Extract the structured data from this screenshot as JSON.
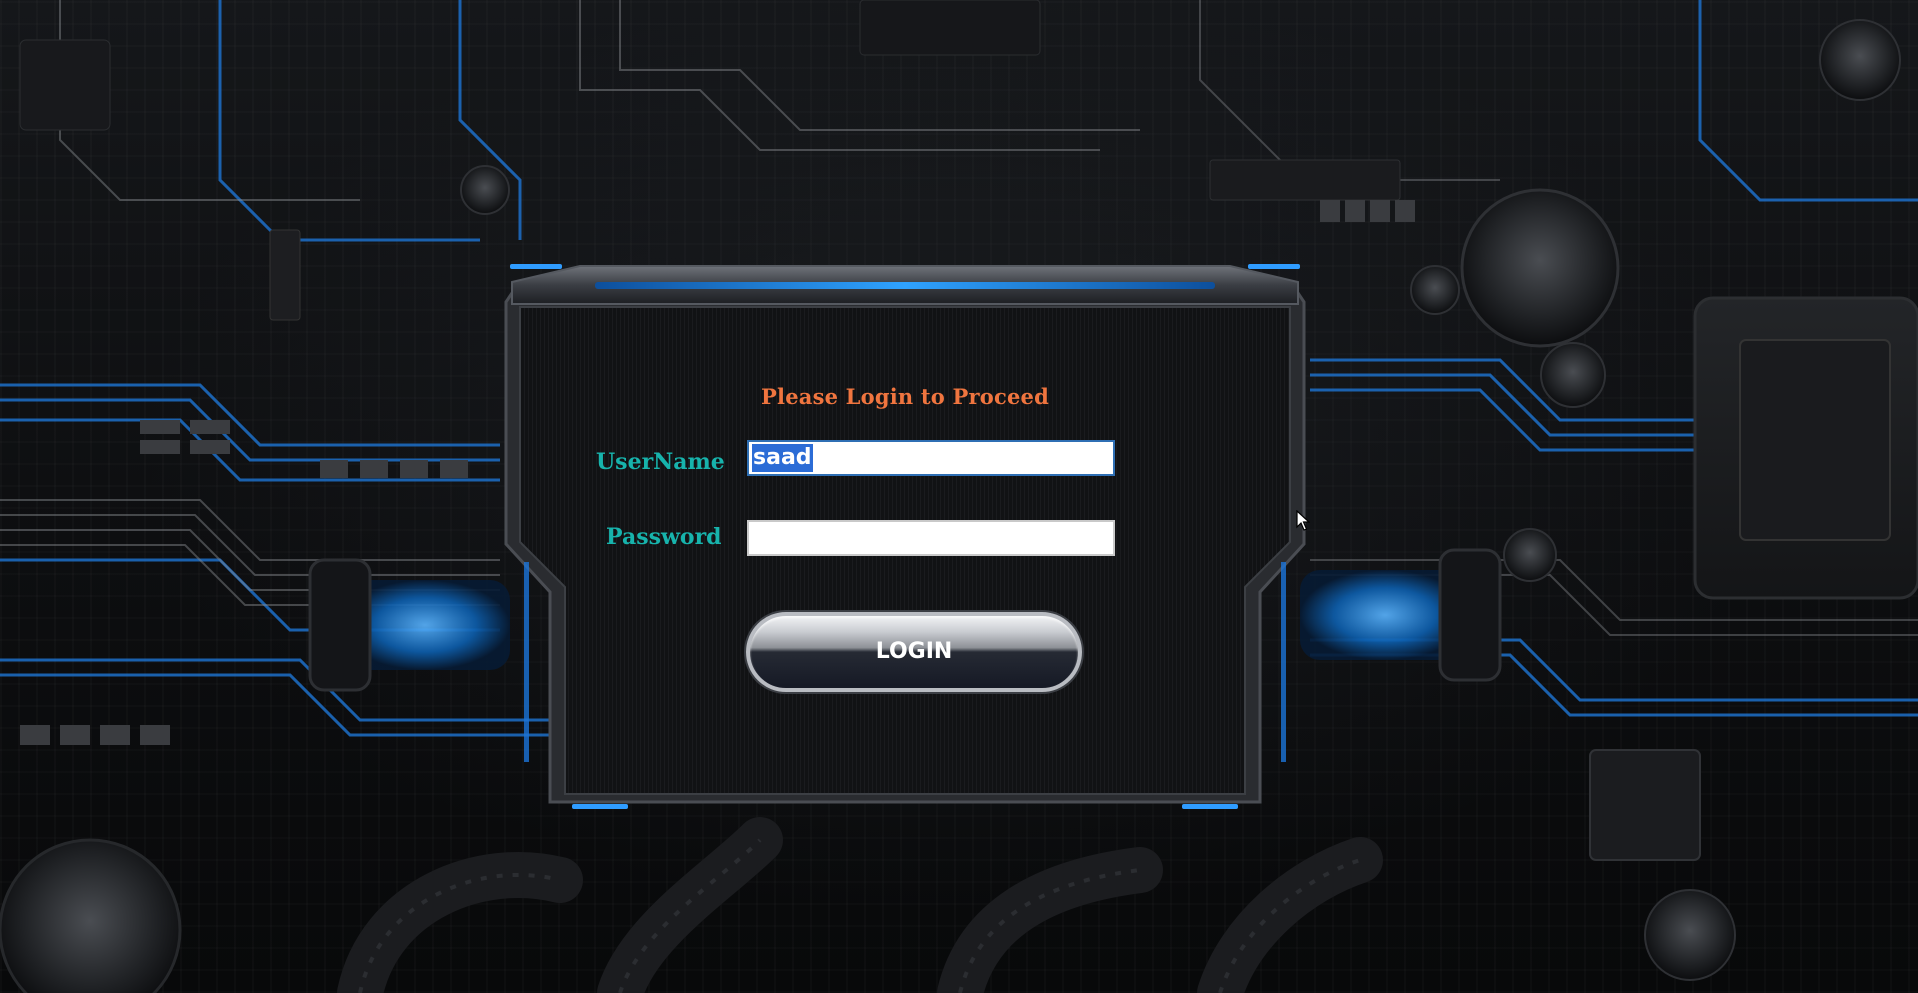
{
  "login": {
    "heading": "Please Login to Proceed",
    "username_label": "UserName",
    "username_value": "saad",
    "password_label": "Password",
    "password_value": "",
    "login_button": "LOGIN"
  },
  "colors": {
    "heading": "#f0753f",
    "label": "#17b3ac",
    "accent_blue": "#1e8fff",
    "selection": "#2b6cd6"
  },
  "icons": {
    "cursor": "mouse-pointer-icon"
  }
}
